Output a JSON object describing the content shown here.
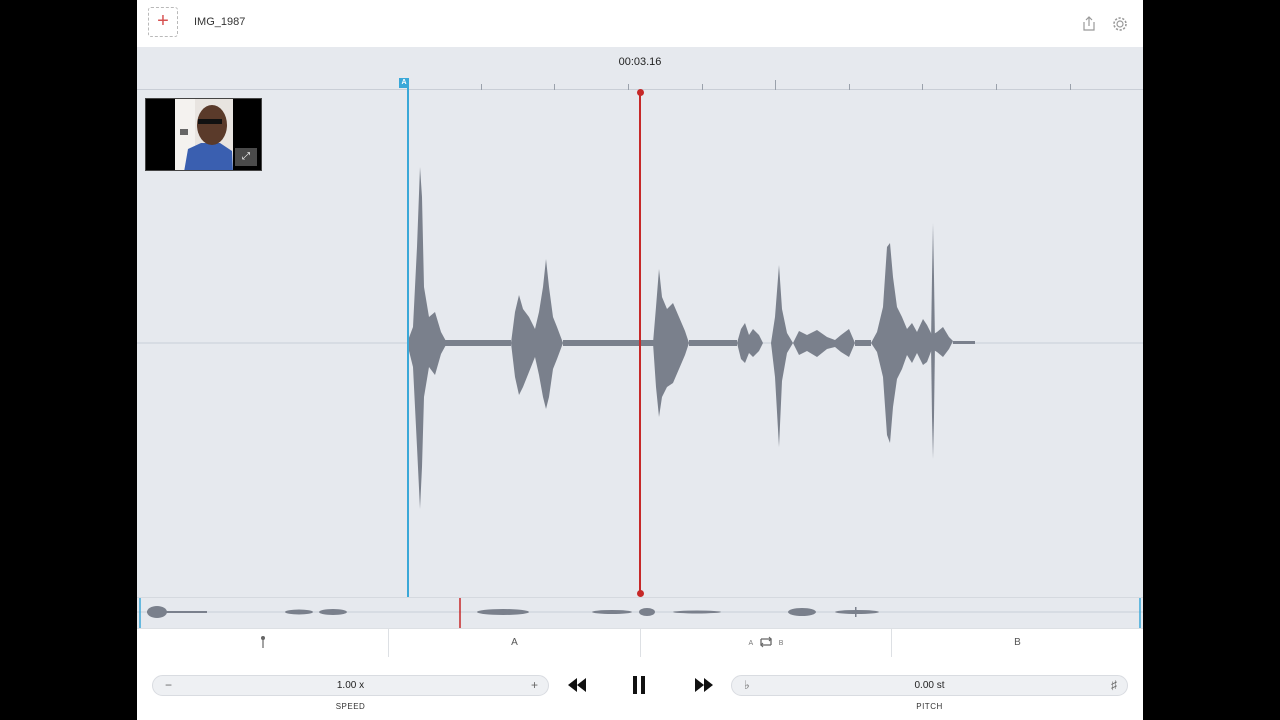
{
  "header": {
    "add_label": "+",
    "file_title": "IMG_1987",
    "share_icon": "share-icon",
    "settings_icon": "gear-icon"
  },
  "timeline": {
    "current_time": "00:03.16",
    "marker_a_label": "A"
  },
  "segments": {
    "pin_icon": "pin-icon",
    "a_label": "A",
    "loop_a": "A",
    "loop_b": "B",
    "loop_icon": "loop-icon",
    "b_label": "B"
  },
  "speed": {
    "minus": "−",
    "value": "1.00 x",
    "plus": "+",
    "caption": "SPEED"
  },
  "transport": {
    "rewind_icon": "rewind-icon",
    "pause_icon": "pause-icon",
    "forward_icon": "fast-forward-icon"
  },
  "pitch": {
    "flat": "♭",
    "value": "0.00 st",
    "sharp": "♯",
    "caption": "PITCH"
  },
  "colors": {
    "accent_blue": "#3aa8d8",
    "playhead_red": "#c62828",
    "waveform": "#7a808c"
  }
}
